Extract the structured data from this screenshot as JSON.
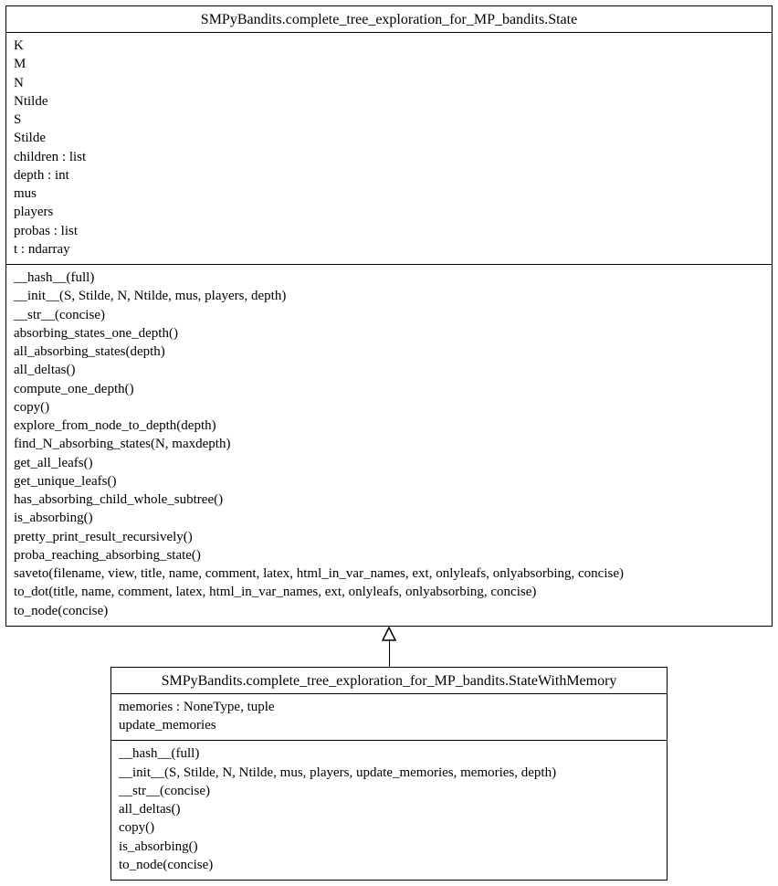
{
  "parent": {
    "title": "SMPyBandits.complete_tree_exploration_for_MP_bandits.State",
    "attrs": {
      "a0": "K",
      "a1": "M",
      "a2": "N",
      "a3": "Ntilde",
      "a4": "S",
      "a5": "Stilde",
      "a6": "children : list",
      "a7": "depth : int",
      "a8": "mus",
      "a9": "players",
      "a10": "probas : list",
      "a11": "t : ndarray"
    },
    "methods": {
      "m0": "__hash__(full)",
      "m1": "__init__(S, Stilde, N, Ntilde, mus, players, depth)",
      "m2": "__str__(concise)",
      "m3": "absorbing_states_one_depth()",
      "m4": "all_absorbing_states(depth)",
      "m5": "all_deltas()",
      "m6": "compute_one_depth()",
      "m7": "copy()",
      "m8": "explore_from_node_to_depth(depth)",
      "m9": "find_N_absorbing_states(N, maxdepth)",
      "m10": "get_all_leafs()",
      "m11": "get_unique_leafs()",
      "m12": "has_absorbing_child_whole_subtree()",
      "m13": "is_absorbing()",
      "m14": "pretty_print_result_recursively()",
      "m15": "proba_reaching_absorbing_state()",
      "m16": "saveto(filename, view, title, name, comment, latex, html_in_var_names, ext, onlyleafs, onlyabsorbing, concise)",
      "m17": "to_dot(title, name, comment, latex, html_in_var_names, ext, onlyleafs, onlyabsorbing, concise)",
      "m18": "to_node(concise)"
    }
  },
  "child": {
    "title": "SMPyBandits.complete_tree_exploration_for_MP_bandits.StateWithMemory",
    "attrs": {
      "a0": "memories : NoneType, tuple",
      "a1": "update_memories"
    },
    "methods": {
      "m0": "__hash__(full)",
      "m1": "__init__(S, Stilde, N, Ntilde, mus, players, update_memories, memories, depth)",
      "m2": "__str__(concise)",
      "m3": "all_deltas()",
      "m4": "copy()",
      "m5": "is_absorbing()",
      "m6": "to_node(concise)"
    }
  }
}
